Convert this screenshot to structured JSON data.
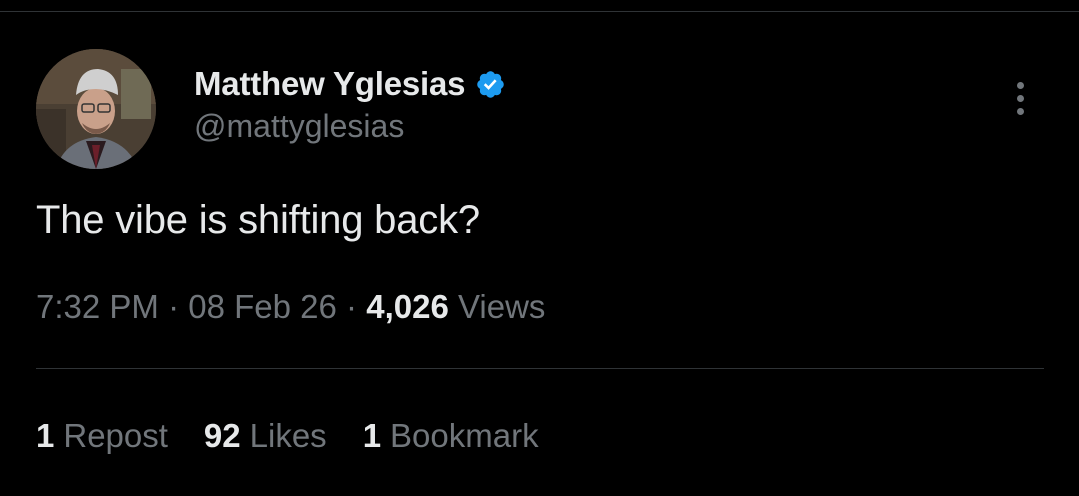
{
  "author": {
    "display_name": "Matthew Yglesias",
    "handle": "@mattyglesias",
    "verified_badge_color": "#1d9bf0",
    "avatar_icon": "avatar-photo"
  },
  "more_icon": "more-vertical-icon",
  "tweet": {
    "text": "The vibe is shifting back?"
  },
  "meta": {
    "time": "7:32 PM",
    "separator": "·",
    "date": "08 Feb 26",
    "views_count": "4,026",
    "views_label": "Views"
  },
  "stats": {
    "reposts_count": "1",
    "reposts_label": "Repost",
    "likes_count": "92",
    "likes_label": "Likes",
    "bookmarks_count": "1",
    "bookmarks_label": "Bookmark"
  },
  "colors": {
    "background": "#000000",
    "primary_text": "#e7e9ea",
    "secondary_text": "#71767b",
    "divider": "#2f3336"
  }
}
